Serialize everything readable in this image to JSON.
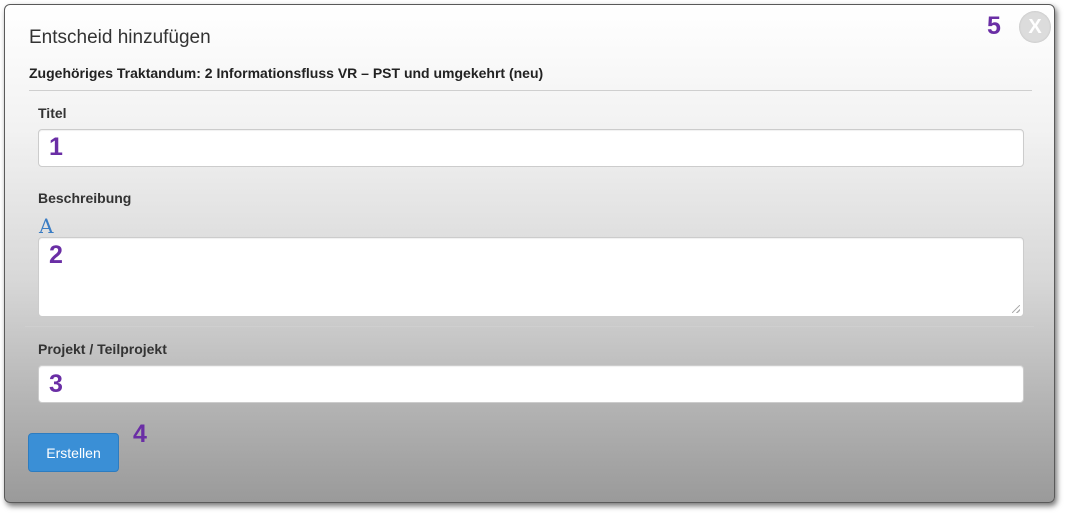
{
  "dialog": {
    "title": "Entscheid hinzufügen",
    "subtitle": "Zugehöriges Traktandum: 2 Informationsfluss VR – PST und umgekehrt (neu)",
    "close_label": "X"
  },
  "form": {
    "title_label": "Titel",
    "title_value": "",
    "description_label": "Beschreibung",
    "description_value": "",
    "font_icon_glyph": "A",
    "project_label": "Projekt / Teilprojekt",
    "project_value": "",
    "submit_label": "Erstellen"
  },
  "markers": {
    "title_field": "1",
    "description_field": "2",
    "project_field": "3",
    "submit_button": "4",
    "close_button": "5"
  },
  "colors": {
    "primary_button": "#3a8fd6",
    "marker": "#6a2ea5",
    "font_icon": "#3b7dc4"
  },
  "icons": {
    "font_icon": "text-format-icon",
    "close": "close-icon",
    "resize": "resize-grip-icon"
  }
}
